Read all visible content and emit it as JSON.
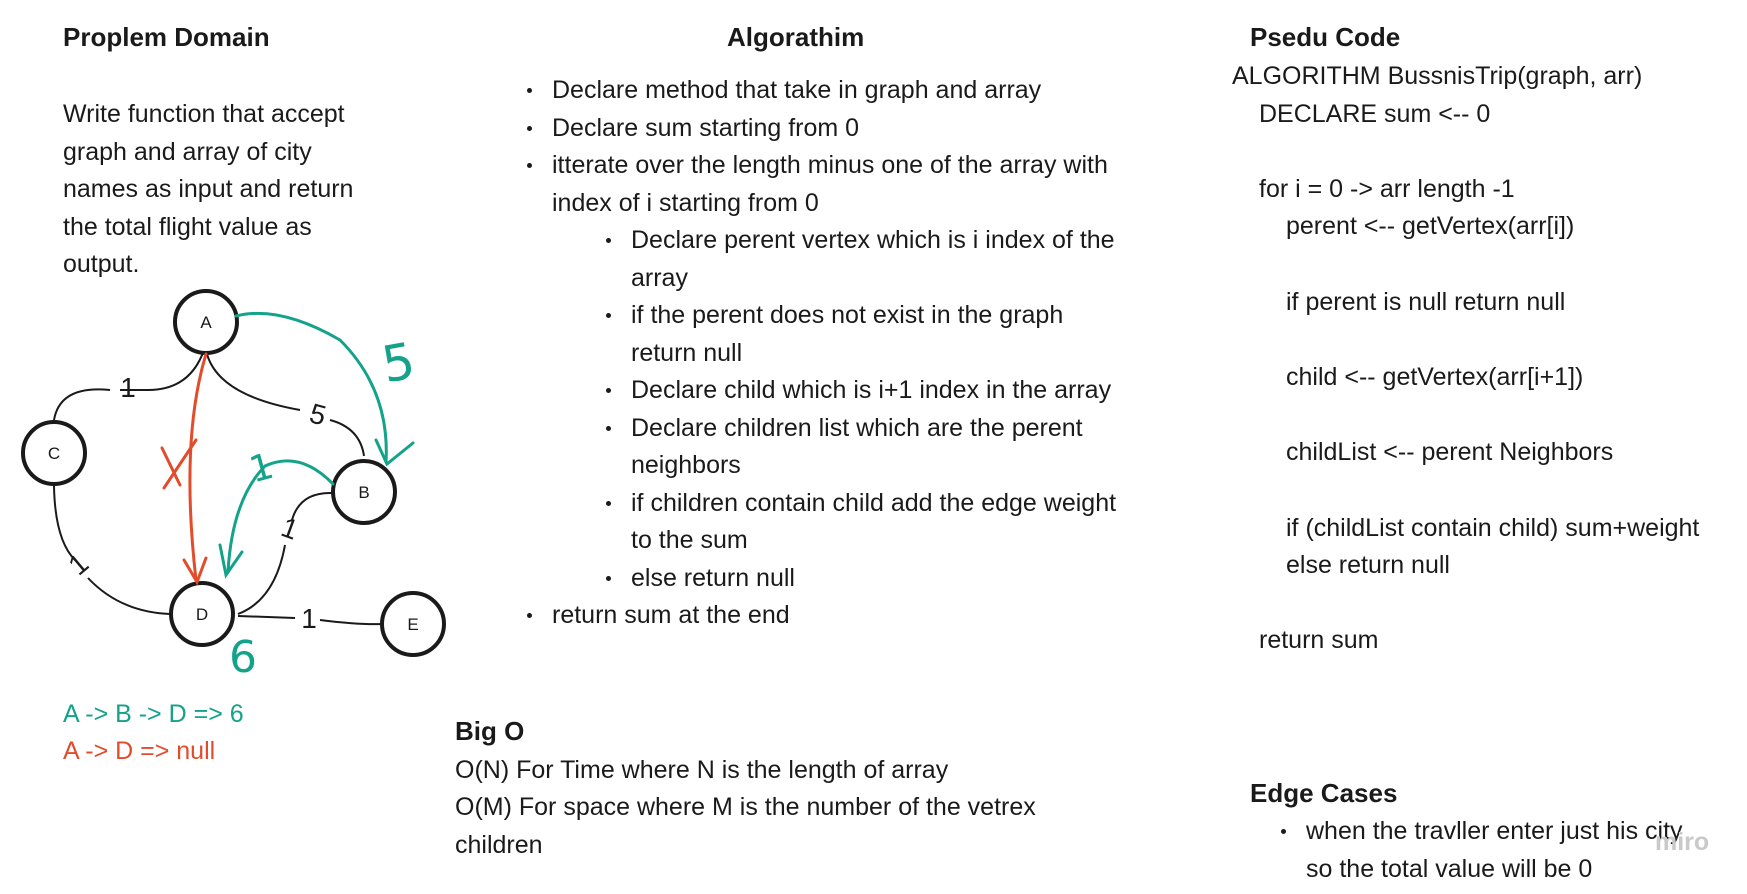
{
  "problem": {
    "title": "Proplem Domain",
    "lines": [
      "Write function that accept",
      "graph and array of city",
      "names as input and return",
      "the total flight value as",
      "output."
    ]
  },
  "graph": {
    "nodes": {
      "a": "A",
      "b": "B",
      "c": "C",
      "d": "D",
      "e": "E"
    },
    "edge_labels": {
      "ac": "1",
      "ab": "5",
      "bd": "1",
      "cd": "1",
      "de": "1"
    },
    "annotations": {
      "green_5": "5",
      "green_1": "1",
      "green_6": "6"
    },
    "colors": {
      "green": "#14a28a",
      "red": "#e24c2b"
    }
  },
  "results": {
    "green_path": "A -> B -> D  => 6",
    "red_path": "A -> D => null"
  },
  "algorithm": {
    "title": "Algorathim",
    "steps": [
      "Declare method that take in graph and array",
      "Declare sum starting from 0",
      "itterate over the length minus one of the array with",
      "index of i starting from 0"
    ],
    "substeps": [
      "Declare perent vertex which is i index of the",
      "array",
      "if the perent does not exist in the  graph",
      "return null",
      "Declare  child which is i+1 index in the array",
      "Declare children list which are the perent",
      "neighbors",
      "if children contain child add the edge weight",
      "to the sum",
      "else return null"
    ],
    "last_step": "return sum at the end"
  },
  "bigo": {
    "title": "Big O",
    "time": "O(N) For Time where N is the length of array",
    "space": "O(M) For space where M is the number of the vetrex",
    "space2": "children"
  },
  "pseudo": {
    "title": "Psedu Code",
    "lines": [
      "ALGORITHM BussnisTrip(graph, arr)",
      "DECLARE sum <-- 0",
      "for i = 0 -> arr length -1",
      "perent <-- getVertex(arr[i])",
      "if perent is null return null",
      "child <-- getVertex(arr[i+1])",
      "childList <-- perent Neighbors",
      "if (childList contain child) sum+weight",
      "else return null",
      "return sum"
    ]
  },
  "edge_cases": {
    "title": "Edge Cases",
    "line1": "when the travller enter just his city",
    "line2": "so the total value will be 0"
  },
  "watermark": "miro"
}
